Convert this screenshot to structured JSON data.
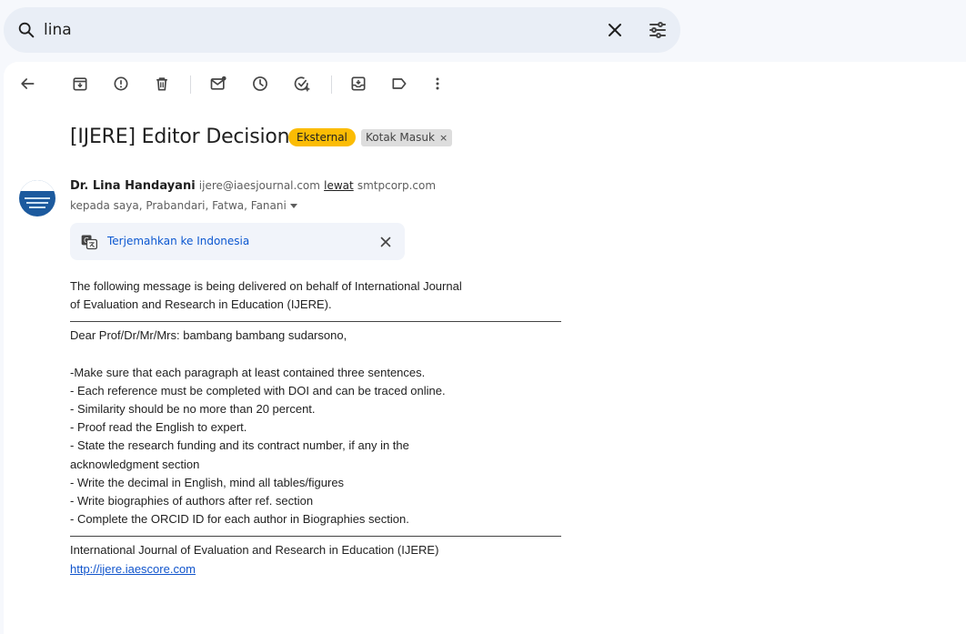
{
  "search": {
    "query": "lina"
  },
  "email": {
    "subject": "[IJERE] Editor Decision",
    "label_external": "Eksternal",
    "label_inbox": "Kotak Masuk",
    "label_inbox_remove": "×",
    "sender_name": "Dr. Lina Handayani",
    "sender_email": "ijere@iaesjournal.com",
    "sender_via": "lewat",
    "sender_domain": "smtpcorp.com",
    "recipients": "kepada saya, Prabandari, Fatwa, Fanani",
    "translate_link": "Terjemahkan ke Indonesia",
    "body_intro": "The following message is being delivered on behalf of International Journal\nof Evaluation and Research in Education (IJERE).",
    "body_greeting": "Dear Prof/Dr/Mr/Mrs: bambang bambang sudarsono,",
    "body_items": "-Make sure that each paragraph at least contained three sentences.\n- Each reference must be completed with DOI and can be traced online.\n- Similarity should be no more than 20 percent.\n- Proof read the English to expert.\n- State the research funding and its contract number, if any in the\nacknowledgment section\n- Write the decimal in English, mind all tables/figures\n- Write biographies of authors after ref. section\n- Complete the ORCID ID for each author in Biographies section.",
    "footer_journal": "International Journal of Evaluation and Research in Education (IJERE)",
    "footer_link": "http://ijere.iaescore.com"
  },
  "icons": {
    "search": "search-icon",
    "clear": "close-icon",
    "filter": "tune-icon",
    "back": "arrow-back-icon",
    "archive": "archive-icon",
    "spam": "report-spam-icon",
    "delete": "trash-icon",
    "unread": "mark-unread-icon",
    "snooze": "snooze-icon",
    "task": "add-task-icon",
    "move": "move-to-icon",
    "label": "label-icon",
    "more": "more-vert-icon",
    "translate": "translate-icon"
  },
  "colors": {
    "external_badge": "#fbbc04",
    "link": "#0b57d0",
    "search_bg": "#e9eef6"
  }
}
